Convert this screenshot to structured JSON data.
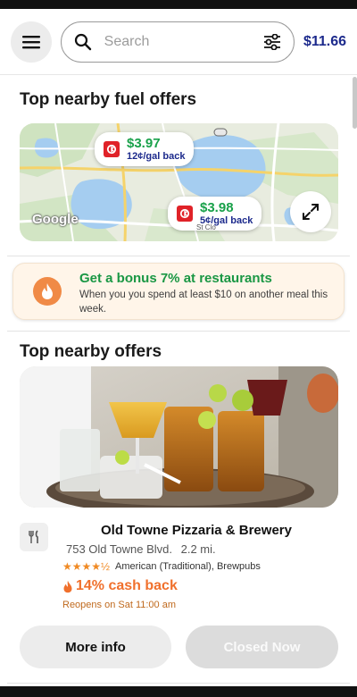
{
  "header": {
    "search_placeholder": "Search",
    "balance": "$11.66"
  },
  "fuel_section": {
    "title": "Top nearby fuel offers",
    "offers": [
      {
        "price": "$3.97",
        "cashback": "12¢/gal back"
      },
      {
        "price": "$3.98",
        "cashback": "5¢/gal back"
      }
    ],
    "map_labels": {
      "google": "Google",
      "place_fragment": "St Clo"
    }
  },
  "bonus": {
    "title": "Get a bonus 7% at restaurants",
    "description": "When you you spend at least $10 on another meal this week."
  },
  "offers_section": {
    "title": "Top nearby offers",
    "offer": {
      "name": "Old Towne Pizzaria & Brewery",
      "address": "753 Old Towne Blvd.",
      "distance": "2.2 mi.",
      "rating": 4.5,
      "stars": "★★★★½",
      "cuisine": "American (Traditional), Brewpubs",
      "cashback": "14% cash back",
      "hours_note": "Reopens on Sat 11:00 am"
    },
    "buttons": {
      "more_info": "More info",
      "closed": "Closed Now"
    }
  },
  "colors": {
    "brand_green": "#1a9744",
    "brand_navy": "#1c2a8c",
    "accent_orange": "#f0702c",
    "bonus_bg": "#fff5e9"
  }
}
